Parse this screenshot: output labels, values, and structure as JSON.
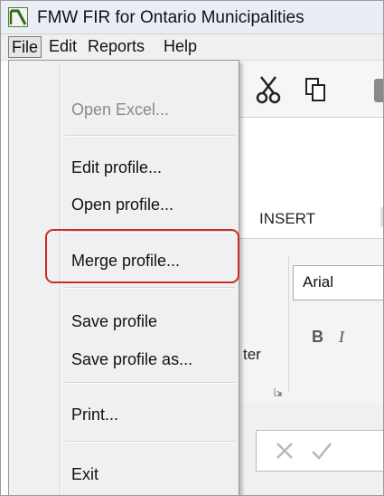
{
  "window": {
    "title": "FMW FIR for Ontario Municipalities",
    "icon": "app-logo-icon"
  },
  "menubar": {
    "items": [
      "File",
      "Edit",
      "Reports",
      "Help"
    ],
    "active": "File"
  },
  "file_menu": {
    "items": [
      {
        "label": "Open Excel...",
        "enabled": false
      },
      {
        "label": "Edit profile...",
        "enabled": true
      },
      {
        "label": "Open profile...",
        "enabled": true
      },
      {
        "label": "Merge profile...",
        "enabled": true,
        "highlighted": true
      },
      {
        "label": "Save profile",
        "enabled": true
      },
      {
        "label": "Save profile as...",
        "enabled": true
      },
      {
        "label": "Print...",
        "enabled": true
      },
      {
        "label": "Exit",
        "enabled": true
      }
    ],
    "highlight_color": "#cc2b2b"
  },
  "background": {
    "toolbar_icons": [
      "scissors-icon",
      "copy-icon",
      "paste-icon"
    ],
    "ribbon_tab": "INSERT",
    "font_name": "Arial",
    "bold_label": "B",
    "italic_label": "I",
    "partial_label": "ter",
    "formula_icons": [
      "cancel-x-icon",
      "confirm-check-icon"
    ]
  }
}
